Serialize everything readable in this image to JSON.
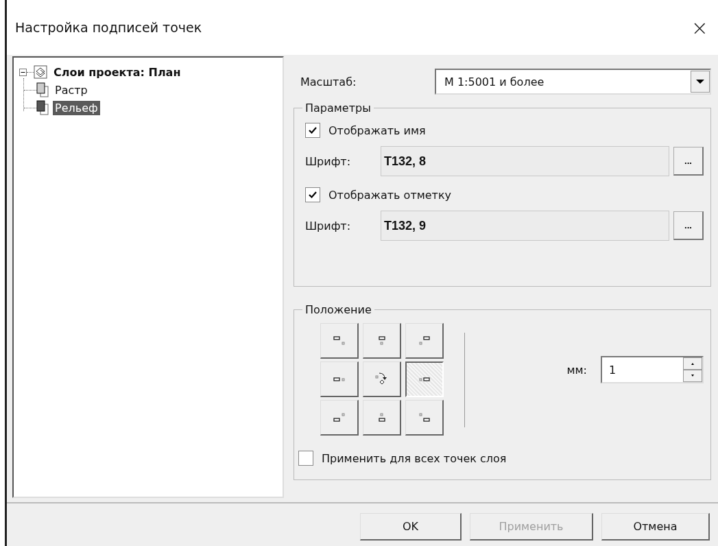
{
  "window": {
    "title": "Настройка подписей точек",
    "close": "×"
  },
  "tree": [
    {
      "label": "Слои проекта: План",
      "expanded": true,
      "selected": false,
      "children": [
        {
          "label": "Растр",
          "selected": false
        },
        {
          "label": "Рельеф",
          "selected": true
        }
      ]
    }
  ],
  "scale": {
    "label": "Масштаб:",
    "value": "М 1:5001 и более"
  },
  "parameters": {
    "title": "Параметры",
    "rows": [
      {
        "checkbox": "Отображать имя",
        "checked": true,
        "font_label": "Шрифт:",
        "font_value": "T132, 8",
        "more": "..."
      },
      {
        "checkbox": "Отображать отметку",
        "checked": true,
        "font_label": "Шрифт:",
        "font_value": "T132, 9",
        "more": "..."
      }
    ]
  },
  "position": {
    "title": "Положение",
    "buttons": [
      {
        "kind": "position",
        "selected": false
      },
      {
        "kind": "position",
        "selected": false
      },
      {
        "kind": "position",
        "selected": false
      },
      {
        "kind": "position",
        "selected": false
      },
      {
        "kind": "auto",
        "selected": false
      },
      {
        "kind": "position",
        "selected": true
      },
      {
        "kind": "position",
        "selected": false
      },
      {
        "kind": "position",
        "selected": false
      },
      {
        "kind": "position",
        "selected": false
      }
    ],
    "offset_label": "мм:",
    "offset_value": "1",
    "apply_all": {
      "label": "Применить для всех точек слоя",
      "checked": false
    }
  },
  "buttons": [
    {
      "label": "OK",
      "disabled": false
    },
    {
      "label": "Применить",
      "disabled": true
    },
    {
      "label": "Отмена",
      "disabled": false
    }
  ]
}
